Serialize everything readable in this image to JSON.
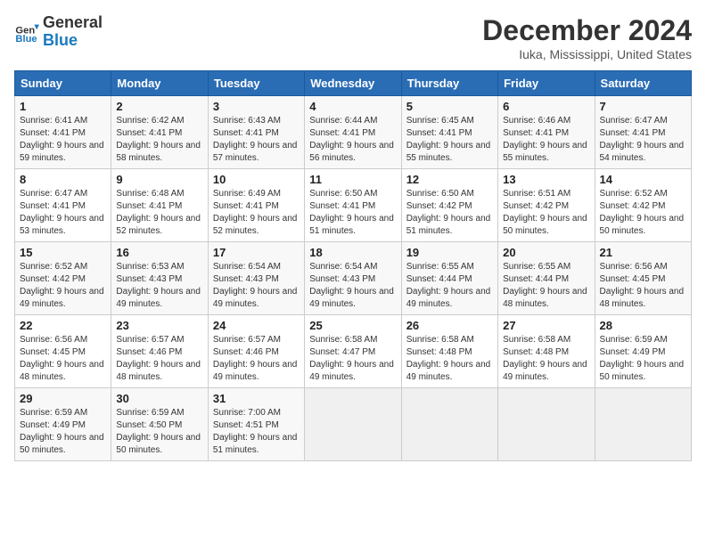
{
  "header": {
    "logo_general": "General",
    "logo_blue": "Blue",
    "month_title": "December 2024",
    "location": "Iuka, Mississippi, United States"
  },
  "days_of_week": [
    "Sunday",
    "Monday",
    "Tuesday",
    "Wednesday",
    "Thursday",
    "Friday",
    "Saturday"
  ],
  "weeks": [
    [
      {
        "day": "1",
        "sunrise": "Sunrise: 6:41 AM",
        "sunset": "Sunset: 4:41 PM",
        "daylight": "Daylight: 9 hours and 59 minutes."
      },
      {
        "day": "2",
        "sunrise": "Sunrise: 6:42 AM",
        "sunset": "Sunset: 4:41 PM",
        "daylight": "Daylight: 9 hours and 58 minutes."
      },
      {
        "day": "3",
        "sunrise": "Sunrise: 6:43 AM",
        "sunset": "Sunset: 4:41 PM",
        "daylight": "Daylight: 9 hours and 57 minutes."
      },
      {
        "day": "4",
        "sunrise": "Sunrise: 6:44 AM",
        "sunset": "Sunset: 4:41 PM",
        "daylight": "Daylight: 9 hours and 56 minutes."
      },
      {
        "day": "5",
        "sunrise": "Sunrise: 6:45 AM",
        "sunset": "Sunset: 4:41 PM",
        "daylight": "Daylight: 9 hours and 55 minutes."
      },
      {
        "day": "6",
        "sunrise": "Sunrise: 6:46 AM",
        "sunset": "Sunset: 4:41 PM",
        "daylight": "Daylight: 9 hours and 55 minutes."
      },
      {
        "day": "7",
        "sunrise": "Sunrise: 6:47 AM",
        "sunset": "Sunset: 4:41 PM",
        "daylight": "Daylight: 9 hours and 54 minutes."
      }
    ],
    [
      {
        "day": "8",
        "sunrise": "Sunrise: 6:47 AM",
        "sunset": "Sunset: 4:41 PM",
        "daylight": "Daylight: 9 hours and 53 minutes."
      },
      {
        "day": "9",
        "sunrise": "Sunrise: 6:48 AM",
        "sunset": "Sunset: 4:41 PM",
        "daylight": "Daylight: 9 hours and 52 minutes."
      },
      {
        "day": "10",
        "sunrise": "Sunrise: 6:49 AM",
        "sunset": "Sunset: 4:41 PM",
        "daylight": "Daylight: 9 hours and 52 minutes."
      },
      {
        "day": "11",
        "sunrise": "Sunrise: 6:50 AM",
        "sunset": "Sunset: 4:41 PM",
        "daylight": "Daylight: 9 hours and 51 minutes."
      },
      {
        "day": "12",
        "sunrise": "Sunrise: 6:50 AM",
        "sunset": "Sunset: 4:42 PM",
        "daylight": "Daylight: 9 hours and 51 minutes."
      },
      {
        "day": "13",
        "sunrise": "Sunrise: 6:51 AM",
        "sunset": "Sunset: 4:42 PM",
        "daylight": "Daylight: 9 hours and 50 minutes."
      },
      {
        "day": "14",
        "sunrise": "Sunrise: 6:52 AM",
        "sunset": "Sunset: 4:42 PM",
        "daylight": "Daylight: 9 hours and 50 minutes."
      }
    ],
    [
      {
        "day": "15",
        "sunrise": "Sunrise: 6:52 AM",
        "sunset": "Sunset: 4:42 PM",
        "daylight": "Daylight: 9 hours and 49 minutes."
      },
      {
        "day": "16",
        "sunrise": "Sunrise: 6:53 AM",
        "sunset": "Sunset: 4:43 PM",
        "daylight": "Daylight: 9 hours and 49 minutes."
      },
      {
        "day": "17",
        "sunrise": "Sunrise: 6:54 AM",
        "sunset": "Sunset: 4:43 PM",
        "daylight": "Daylight: 9 hours and 49 minutes."
      },
      {
        "day": "18",
        "sunrise": "Sunrise: 6:54 AM",
        "sunset": "Sunset: 4:43 PM",
        "daylight": "Daylight: 9 hours and 49 minutes."
      },
      {
        "day": "19",
        "sunrise": "Sunrise: 6:55 AM",
        "sunset": "Sunset: 4:44 PM",
        "daylight": "Daylight: 9 hours and 49 minutes."
      },
      {
        "day": "20",
        "sunrise": "Sunrise: 6:55 AM",
        "sunset": "Sunset: 4:44 PM",
        "daylight": "Daylight: 9 hours and 48 minutes."
      },
      {
        "day": "21",
        "sunrise": "Sunrise: 6:56 AM",
        "sunset": "Sunset: 4:45 PM",
        "daylight": "Daylight: 9 hours and 48 minutes."
      }
    ],
    [
      {
        "day": "22",
        "sunrise": "Sunrise: 6:56 AM",
        "sunset": "Sunset: 4:45 PM",
        "daylight": "Daylight: 9 hours and 48 minutes."
      },
      {
        "day": "23",
        "sunrise": "Sunrise: 6:57 AM",
        "sunset": "Sunset: 4:46 PM",
        "daylight": "Daylight: 9 hours and 48 minutes."
      },
      {
        "day": "24",
        "sunrise": "Sunrise: 6:57 AM",
        "sunset": "Sunset: 4:46 PM",
        "daylight": "Daylight: 9 hours and 49 minutes."
      },
      {
        "day": "25",
        "sunrise": "Sunrise: 6:58 AM",
        "sunset": "Sunset: 4:47 PM",
        "daylight": "Daylight: 9 hours and 49 minutes."
      },
      {
        "day": "26",
        "sunrise": "Sunrise: 6:58 AM",
        "sunset": "Sunset: 4:48 PM",
        "daylight": "Daylight: 9 hours and 49 minutes."
      },
      {
        "day": "27",
        "sunrise": "Sunrise: 6:58 AM",
        "sunset": "Sunset: 4:48 PM",
        "daylight": "Daylight: 9 hours and 49 minutes."
      },
      {
        "day": "28",
        "sunrise": "Sunrise: 6:59 AM",
        "sunset": "Sunset: 4:49 PM",
        "daylight": "Daylight: 9 hours and 50 minutes."
      }
    ],
    [
      {
        "day": "29",
        "sunrise": "Sunrise: 6:59 AM",
        "sunset": "Sunset: 4:49 PM",
        "daylight": "Daylight: 9 hours and 50 minutes."
      },
      {
        "day": "30",
        "sunrise": "Sunrise: 6:59 AM",
        "sunset": "Sunset: 4:50 PM",
        "daylight": "Daylight: 9 hours and 50 minutes."
      },
      {
        "day": "31",
        "sunrise": "Sunrise: 7:00 AM",
        "sunset": "Sunset: 4:51 PM",
        "daylight": "Daylight: 9 hours and 51 minutes."
      },
      null,
      null,
      null,
      null
    ]
  ]
}
